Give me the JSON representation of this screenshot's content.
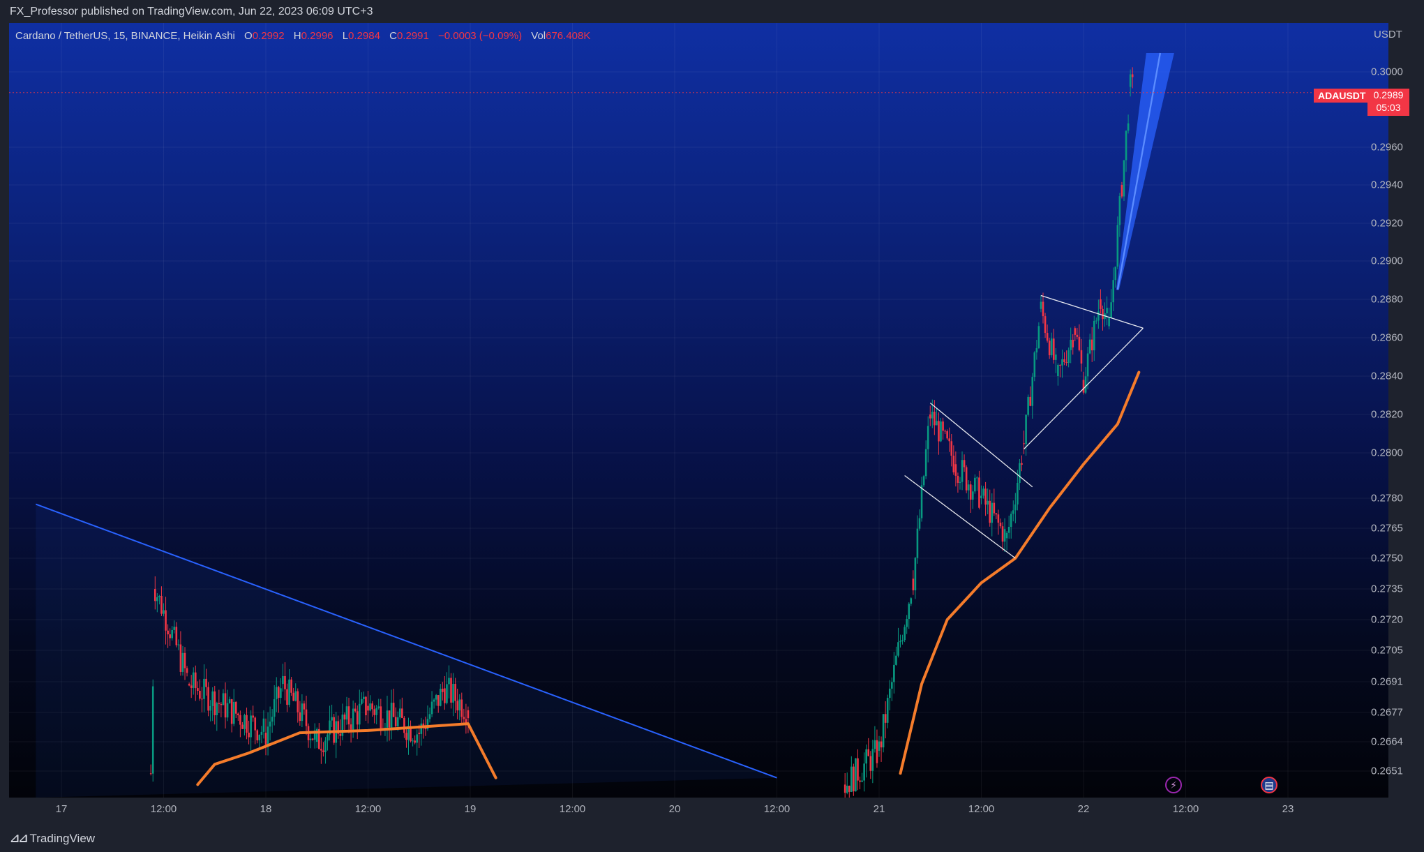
{
  "header": {
    "title": "FX_Professor published on TradingView.com, Jun 22, 2023 06:09 UTC+3"
  },
  "legend": {
    "symbol": "Cardano / TetherUS, 15, BINANCE, Heikin Ashi",
    "o_label": "O",
    "o_value": "0.2992",
    "h_label": "H",
    "h_value": "0.2996",
    "l_label": "L",
    "l_value": "0.2984",
    "c_label": "C",
    "c_value": "0.2991",
    "change": "−0.0003 (−0.09%)",
    "vol_label": "Vol",
    "vol_value": "676.408K"
  },
  "price_axis": {
    "unit": "USDT",
    "ticks": [
      "0.3000",
      "0.2960",
      "0.2940",
      "0.2920",
      "0.2900",
      "0.2880",
      "0.2860",
      "0.2840",
      "0.2820",
      "0.2800",
      "0.2780",
      "0.2765",
      "0.2750",
      "0.2735",
      "0.2720",
      "0.2705",
      "0.2691",
      "0.2677",
      "0.2664",
      "0.2651"
    ]
  },
  "time_axis": {
    "ticks": [
      "17",
      "12:00",
      "18",
      "12:00",
      "19",
      "12:00",
      "20",
      "12:00",
      "21",
      "12:00",
      "22",
      "12:00",
      "23"
    ]
  },
  "price_tag": {
    "symbol": "ADAUSDT",
    "price": "0.2989",
    "countdown": "05:03"
  },
  "footer": {
    "brand": "TradingView"
  },
  "event_icons": [
    {
      "name": "lightning-icon",
      "glyph": "⚡"
    },
    {
      "name": "us-flag-icon",
      "glyph": "▤"
    }
  ],
  "colors": {
    "bull": "#089981",
    "bear": "#f23645",
    "ma": "#f57c2b",
    "trendline": "#2962ff",
    "projection": "#2962ff",
    "pattern": "#ffffff"
  },
  "chart_data": {
    "type": "candlestick",
    "symbol": "ADAUSDT",
    "interval": "15",
    "style": "Heikin Ashi",
    "ylim": [
      0.2648,
      0.301
    ],
    "x_range": [
      "Jun 16 21:00",
      "Jun 23 06:00"
    ],
    "grid": true,
    "swings": [
      {
        "t": "Jun 17 10:30",
        "price": 0.265
      },
      {
        "t": "Jun 17 11:00",
        "price": 0.2735
      },
      {
        "t": "Jun 17 15:00",
        "price": 0.269
      },
      {
        "t": "Jun 18 00:00",
        "price": 0.2668
      },
      {
        "t": "Jun 18 02:00",
        "price": 0.269
      },
      {
        "t": "Jun 18 06:00",
        "price": 0.2664
      },
      {
        "t": "Jun 18 12:00",
        "price": 0.268
      },
      {
        "t": "Jun 18 18:00",
        "price": 0.2668
      },
      {
        "t": "Jun 18 21:00",
        "price": 0.2688
      },
      {
        "t": "Jun 18 23:45",
        "price": 0.2678
      },
      {
        "t": "Jun 19 00:00",
        "price": 0.264
      },
      {
        "t": "Jun 20 20:00",
        "price": 0.2645
      },
      {
        "t": "Jun 21 00:00",
        "price": 0.266
      },
      {
        "t": "Jun 21 04:00",
        "price": 0.274
      },
      {
        "t": "Jun 21 06:00",
        "price": 0.282
      },
      {
        "t": "Jun 21 09:00",
        "price": 0.2795
      },
      {
        "t": "Jun 21 12:00",
        "price": 0.278
      },
      {
        "t": "Jun 21 15:00",
        "price": 0.276
      },
      {
        "t": "Jun 21 17:00",
        "price": 0.2805
      },
      {
        "t": "Jun 21 19:00",
        "price": 0.2875
      },
      {
        "t": "Jun 21 21:00",
        "price": 0.284
      },
      {
        "t": "Jun 21 23:00",
        "price": 0.2865
      },
      {
        "t": "Jun 22 00:00",
        "price": 0.2838
      },
      {
        "t": "Jun 22 02:00",
        "price": 0.288
      },
      {
        "t": "Jun 22 03:00",
        "price": 0.2866
      },
      {
        "t": "Jun 22 04:30",
        "price": 0.294
      },
      {
        "t": "Jun 22 05:30",
        "price": 0.2992
      },
      {
        "t": "Jun 22 06:00",
        "price": 0.2991
      }
    ],
    "last_price": 0.2989,
    "moving_average": [
      {
        "t": "Jun 17 16:00",
        "price": 0.2645
      },
      {
        "t": "Jun 17 18:00",
        "price": 0.2654
      },
      {
        "t": "Jun 17 22:00",
        "price": 0.2659
      },
      {
        "t": "Jun 18 04:00",
        "price": 0.2668
      },
      {
        "t": "Jun 18 12:00",
        "price": 0.2669
      },
      {
        "t": "Jun 18 23:45",
        "price": 0.2672
      },
      {
        "t": "Jun 19 03:00",
        "price": 0.2648
      },
      {
        "t": "Jun 21 02:30",
        "price": 0.265
      },
      {
        "t": "Jun 21 05:00",
        "price": 0.269
      },
      {
        "t": "Jun 21 08:00",
        "price": 0.272
      },
      {
        "t": "Jun 21 12:00",
        "price": 0.2738
      },
      {
        "t": "Jun 21 16:00",
        "price": 0.275
      },
      {
        "t": "Jun 21 20:00",
        "price": 0.2775
      },
      {
        "t": "Jun 22 00:00",
        "price": 0.2795
      },
      {
        "t": "Jun 22 04:00",
        "price": 0.2815
      },
      {
        "t": "Jun 22 06:30",
        "price": 0.2842
      }
    ],
    "drawings": [
      {
        "kind": "trendline",
        "from": {
          "t": "Jun 16 21:00",
          "price": 0.2777
        },
        "to": {
          "t": "Jun 20 12:00",
          "price": 0.2648
        }
      },
      {
        "kind": "channel-upper",
        "from": {
          "t": "Jun 21 06:00",
          "price": 0.2826
        },
        "to": {
          "t": "Jun 21 18:00",
          "price": 0.2785
        }
      },
      {
        "kind": "channel-lower",
        "from": {
          "t": "Jun 21 03:00",
          "price": 0.279
        },
        "to": {
          "t": "Jun 21 16:00",
          "price": 0.275
        }
      },
      {
        "kind": "triangle-upper",
        "from": {
          "t": "Jun 21 19:00",
          "price": 0.2882
        },
        "to": {
          "t": "Jun 22 07:00",
          "price": 0.2865
        }
      },
      {
        "kind": "triangle-lower",
        "from": {
          "t": "Jun 21 17:00",
          "price": 0.2802
        },
        "to": {
          "t": "Jun 22 07:00",
          "price": 0.2865
        }
      },
      {
        "kind": "projection",
        "from": {
          "t": "Jun 22 04:00",
          "price": 0.2885
        },
        "to": {
          "t": "Jun 22 09:00",
          "price": 0.301
        }
      }
    ]
  }
}
